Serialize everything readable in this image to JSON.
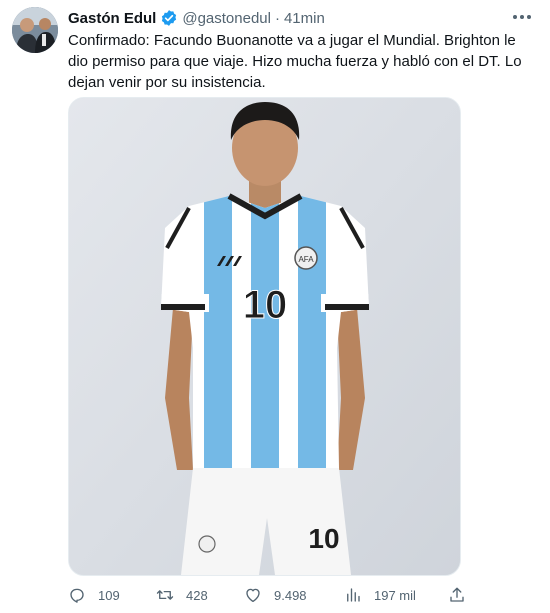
{
  "author": {
    "name": "Gastón Edul",
    "handle": "@gastonedul",
    "separator": "·",
    "time": "41min"
  },
  "tweet_text": "Confirmado: Facundo Buonanotte va a jugar el Mundial. Brighton le dio permiso para que viaje. Hizo mucha fuerza y habló con el DT. Lo dejan venir por su insistencia.",
  "media": {
    "jersey_number": "10",
    "shorts_number": "10",
    "crest": "AFA"
  },
  "actions": {
    "replies": "109",
    "retweets": "428",
    "likes": "9.498",
    "views": "197 mil"
  },
  "colors": {
    "verified": "#1d9bf0",
    "icon": "#536471",
    "text": "#0f1419",
    "stripe": "#74b9e6"
  }
}
